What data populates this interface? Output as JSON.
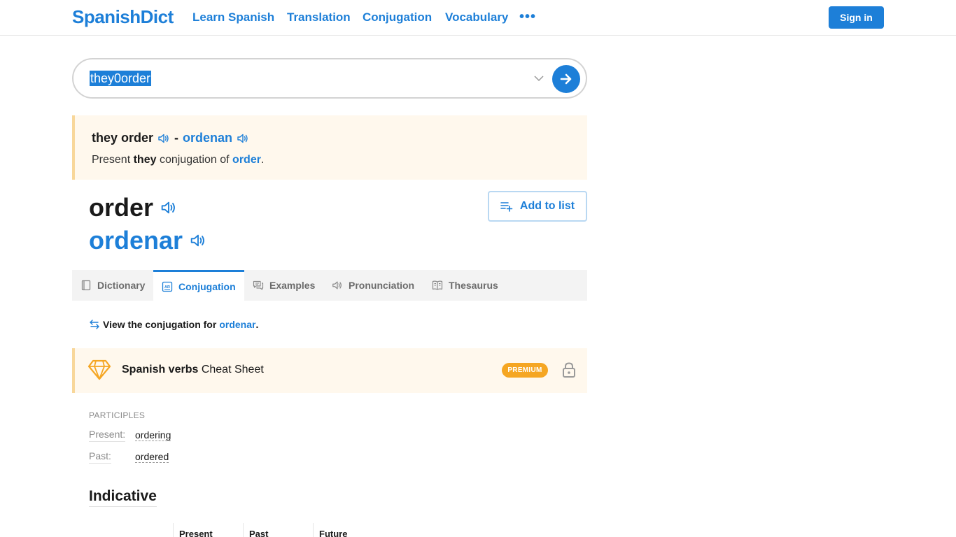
{
  "header": {
    "logo": "SpanishDict",
    "nav": [
      "Learn Spanish",
      "Translation",
      "Conjugation",
      "Vocabulary"
    ],
    "more": "•••",
    "sign_in": "Sign in"
  },
  "search": {
    "value": "they0order"
  },
  "quick_definition": {
    "en": "they order",
    "dash": "-",
    "es": "ordenan",
    "sentence_prefix": "Present",
    "sentence_pronoun": "they",
    "sentence_middle": "conjugation of",
    "sentence_verb": "order",
    "sentence_end": "."
  },
  "headword": {
    "en": "order",
    "es": "ordenar",
    "add_to_list": "Add to list"
  },
  "tabs": [
    {
      "label": "Dictionary",
      "icon": "book-icon",
      "active": false
    },
    {
      "label": "Conjugation",
      "icon": "conjugation-icon",
      "active": true
    },
    {
      "label": "Examples",
      "icon": "chat-icon",
      "active": false
    },
    {
      "label": "Pronunciation",
      "icon": "speaker-icon",
      "active": false
    },
    {
      "label": "Thesaurus",
      "icon": "open-book-icon",
      "active": false
    }
  ],
  "view_conjugation": {
    "prefix": "View the conjugation for",
    "verb": "ordenar",
    "suffix": "."
  },
  "cheat_sheet": {
    "bold": "Spanish verbs",
    "rest": "Cheat Sheet",
    "badge": "PREMIUM"
  },
  "participles": {
    "title": "PARTICIPLES",
    "present_label": "Present:",
    "present_value": "ordering",
    "past_label": "Past:",
    "past_value": "ordered"
  },
  "indicative": {
    "title": "Indicative",
    "columns": [
      "Present",
      "Past",
      "Future"
    ]
  },
  "colors": {
    "brand_blue": "#1d7fd8",
    "highlight_bg": "#fff8ed",
    "premium_orange": "#f5a623"
  }
}
